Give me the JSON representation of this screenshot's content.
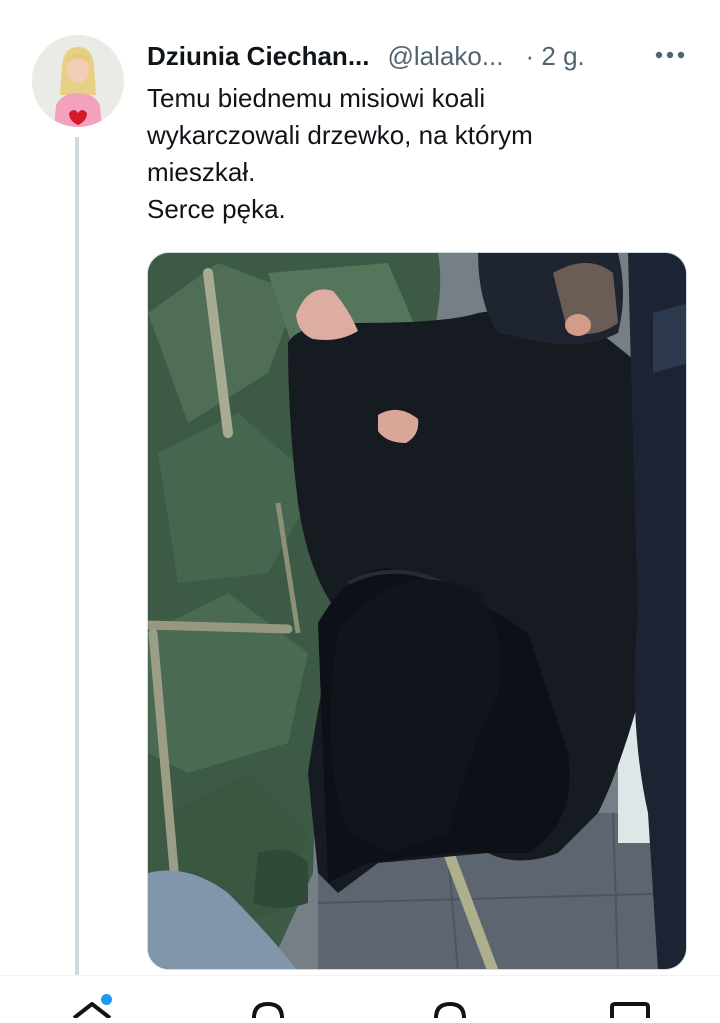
{
  "tweet": {
    "author": {
      "display_name": "Dziunia Ciechan...",
      "handle": "@lalako...",
      "time": "· 2 g."
    },
    "text_lines": [
      "Temu biednemu misiowi koali",
      "wykarczowali drzewko, na którym",
      "mieszkał.",
      "Serce pęka."
    ],
    "more_icon": "more-horizontal-icon",
    "media_icon": "photo"
  },
  "bottom_nav": {
    "items": [
      "home-icon",
      "search-icon",
      "communities-icon",
      "messages-icon"
    ],
    "home_has_notification_dot": true
  },
  "colors": {
    "accent": "#1d9bf0",
    "text_primary": "#0f1419",
    "text_secondary": "#536471",
    "border": "#cfd9de"
  }
}
